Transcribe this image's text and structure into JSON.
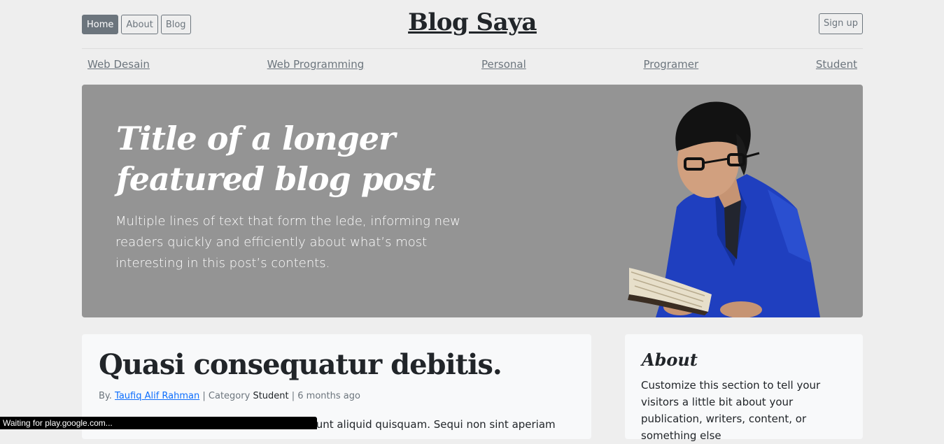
{
  "header": {
    "nav": [
      {
        "label": "Home",
        "active": true
      },
      {
        "label": "About",
        "active": false
      },
      {
        "label": "Blog",
        "active": false
      }
    ],
    "brand": "Blog Saya",
    "signup": "Sign up"
  },
  "categories": [
    "Web Desain",
    "Web Programming",
    "Personal",
    "Programer",
    "Student"
  ],
  "hero": {
    "title": "Title of a longer featured blog post",
    "lede": "Multiple lines of text that form the lede, informing new readers quickly and efficiently about what’s most interesting in this post’s contents.",
    "background": "#949494"
  },
  "post": {
    "title": "Quasi consequatur debitis.",
    "meta_by": "By.",
    "author": "Taufiq Alif Rahman",
    "meta_category_label": "| Category",
    "category": "Student",
    "time": "| 6 months ago",
    "body_snippet": "unt aliquid quisquam. Sequi non sint aperiam"
  },
  "about": {
    "title": "About",
    "text": "Customize this section to tell your visitors a little bit about your publication, writers, content, or something else"
  },
  "statusbar": "Waiting for play.google.com...",
  "colors": {
    "page_bg": "#eeeeee",
    "card_bg": "#f8f9fa",
    "link": "#0d6efd",
    "secondary": "#6c757d",
    "jacket": "#1f3fbf"
  }
}
